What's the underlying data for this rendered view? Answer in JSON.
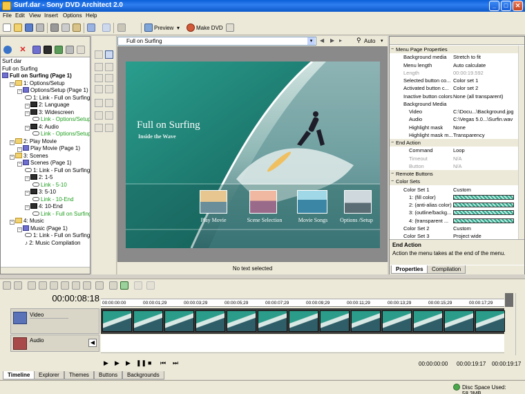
{
  "window": {
    "title": "Surf.dar - Sony DVD Architect 2.0"
  },
  "menu": [
    "File",
    "Edit",
    "View",
    "Insert",
    "Options",
    "Help"
  ],
  "toolbar": {
    "preview_label": "Preview",
    "make_dvd_label": "Make DVD"
  },
  "tree": {
    "nodes": [
      {
        "label": "Surf.dar",
        "icon": "none",
        "level": 0
      },
      {
        "label": "Full on Surfing",
        "icon": "none",
        "level": 0
      },
      {
        "label": "Full on Surfing (Page 1)",
        "icon": "menu",
        "level": 0,
        "bold": true
      },
      {
        "label": "1: Options/Setup",
        "icon": "folder",
        "level": 1
      },
      {
        "label": "Options/Setup (Page 1)",
        "icon": "menu",
        "level": 2
      },
      {
        "label": "1: Link - Full on Surfing",
        "icon": "link",
        "level": 3
      },
      {
        "label": "2: Language",
        "icon": "film",
        "level": 3
      },
      {
        "label": "3: Widescreen",
        "icon": "film",
        "level": 3
      },
      {
        "label": "Link - Options/Setup",
        "icon": "link",
        "level": 4,
        "green": true
      },
      {
        "label": "4: Audio",
        "icon": "film",
        "level": 3
      },
      {
        "label": "Link - Options/Setup",
        "icon": "link",
        "level": 4,
        "green": true
      },
      {
        "label": "2: Play Movie",
        "icon": "folder",
        "level": 1
      },
      {
        "label": "Play Movie (Page 1)",
        "icon": "menu",
        "level": 2
      },
      {
        "label": "3: Scenes",
        "icon": "folder",
        "level": 1
      },
      {
        "label": "Scenes (Page 1)",
        "icon": "menu",
        "level": 2
      },
      {
        "label": "1: Link - Full on Surfing",
        "icon": "link",
        "level": 3
      },
      {
        "label": "2: 1-5",
        "icon": "film",
        "level": 3
      },
      {
        "label": "Link - 5-10",
        "icon": "link",
        "level": 4,
        "green": true
      },
      {
        "label": "3: 5-10",
        "icon": "film",
        "level": 3
      },
      {
        "label": "Link - 10-End",
        "icon": "link",
        "level": 4,
        "green": true
      },
      {
        "label": "4: 10-End",
        "icon": "film",
        "level": 3
      },
      {
        "label": "Link - Full on Surfing",
        "icon": "link",
        "level": 4,
        "green": true
      },
      {
        "label": "4: Music",
        "icon": "folder",
        "level": 1
      },
      {
        "label": "Music (Page 1)",
        "icon": "menu",
        "level": 2
      },
      {
        "label": "1: Link - Full on Surfing",
        "icon": "link",
        "level": 3
      },
      {
        "label": "2: Music Compilation",
        "icon": "note",
        "level": 3
      }
    ]
  },
  "center": {
    "menu_combo": "Full on Surfing",
    "zoom_combo": "Auto",
    "menu_title": "Full on Surfing",
    "menu_subtitle": "Inside the Wave",
    "buttons": [
      "Play Movie",
      "Scene Selection",
      "Movie Songs",
      "Options /Setup"
    ],
    "status": "No text selected"
  },
  "properties": {
    "rows": [
      {
        "type": "cat",
        "key": "Menu Page Properties"
      },
      {
        "key": "Background media",
        "val": "Stretch to fit"
      },
      {
        "key": "Menu length",
        "val": "Auto calculate"
      },
      {
        "key": "Length",
        "val": "00:00:19.592",
        "dis": true
      },
      {
        "key": "Selected button co...",
        "val": "Color set 1"
      },
      {
        "key": "Activated button c...",
        "val": "Color set 2"
      },
      {
        "key": "Inactive button colors",
        "val": "None (all transparent)"
      },
      {
        "key": "Background Media",
        "val": ""
      },
      {
        "type": "sub",
        "key": "Video",
        "val": "C:\\Docu...\\Background.jpg"
      },
      {
        "type": "sub",
        "key": "Audio",
        "val": "C:\\Vegas 5.0...\\Surfin.wav"
      },
      {
        "type": "sub",
        "key": "Highlight mask",
        "val": "None"
      },
      {
        "type": "sub",
        "key": "Highlight mask m...",
        "val": "Transparency"
      },
      {
        "type": "cat",
        "key": "End Action"
      },
      {
        "type": "sub",
        "key": "Command",
        "val": "Loop"
      },
      {
        "type": "sub",
        "key": "Timeout",
        "val": "N/A",
        "dis": true
      },
      {
        "type": "sub",
        "key": "Button",
        "val": "N/A",
        "dis": true
      },
      {
        "type": "cat",
        "key": "Remote Buttons"
      },
      {
        "type": "cat",
        "key": "Color Sets"
      },
      {
        "key": "Color Set 1",
        "val": "Custom"
      },
      {
        "type": "sub",
        "key": "1: (fill color)",
        "val": "",
        "swatch": true
      },
      {
        "type": "sub",
        "key": "2: (anti-alias color)",
        "val": "",
        "swatch": true
      },
      {
        "type": "sub",
        "key": "3: (outline/backg...",
        "val": "",
        "swatch": true
      },
      {
        "type": "sub",
        "key": "4: (transparent ...",
        "val": "",
        "swatch": true
      },
      {
        "key": "Color Set 2",
        "val": "Custom"
      },
      {
        "key": "Color Set 3",
        "val": "Project wide"
      }
    ],
    "desc_title": "End Action",
    "desc_text": "Action the menu takes at the end of the menu.",
    "tabs": [
      "Properties",
      "Compilation"
    ]
  },
  "timeline": {
    "timecode": "00:00:08:18",
    "ruler": [
      "00:00:00:00",
      "00:00:01;29",
      "00:00:03;29",
      "00:00:05;29",
      "00:00:07;29",
      "00:00:09;29",
      "00:00:11;29",
      "00:00:13;29",
      "00:00:15;29",
      "00:00:17;29"
    ],
    "video_label": "Video",
    "audio_label": "Audio",
    "time_start": "00:00:00:00",
    "time_end": "00:00:19:17",
    "time_len": "00:00:19:17"
  },
  "bottom_tabs": [
    "Timeline",
    "Explorer",
    "Themes",
    "Buttons",
    "Backgrounds"
  ],
  "status": {
    "disc_space": "Disc Space Used: 58.3MB"
  },
  "colors": {
    "title_blue": "#0b58c9",
    "menu_teal": "#1f6b62",
    "link_green": "#1f9e1f"
  }
}
